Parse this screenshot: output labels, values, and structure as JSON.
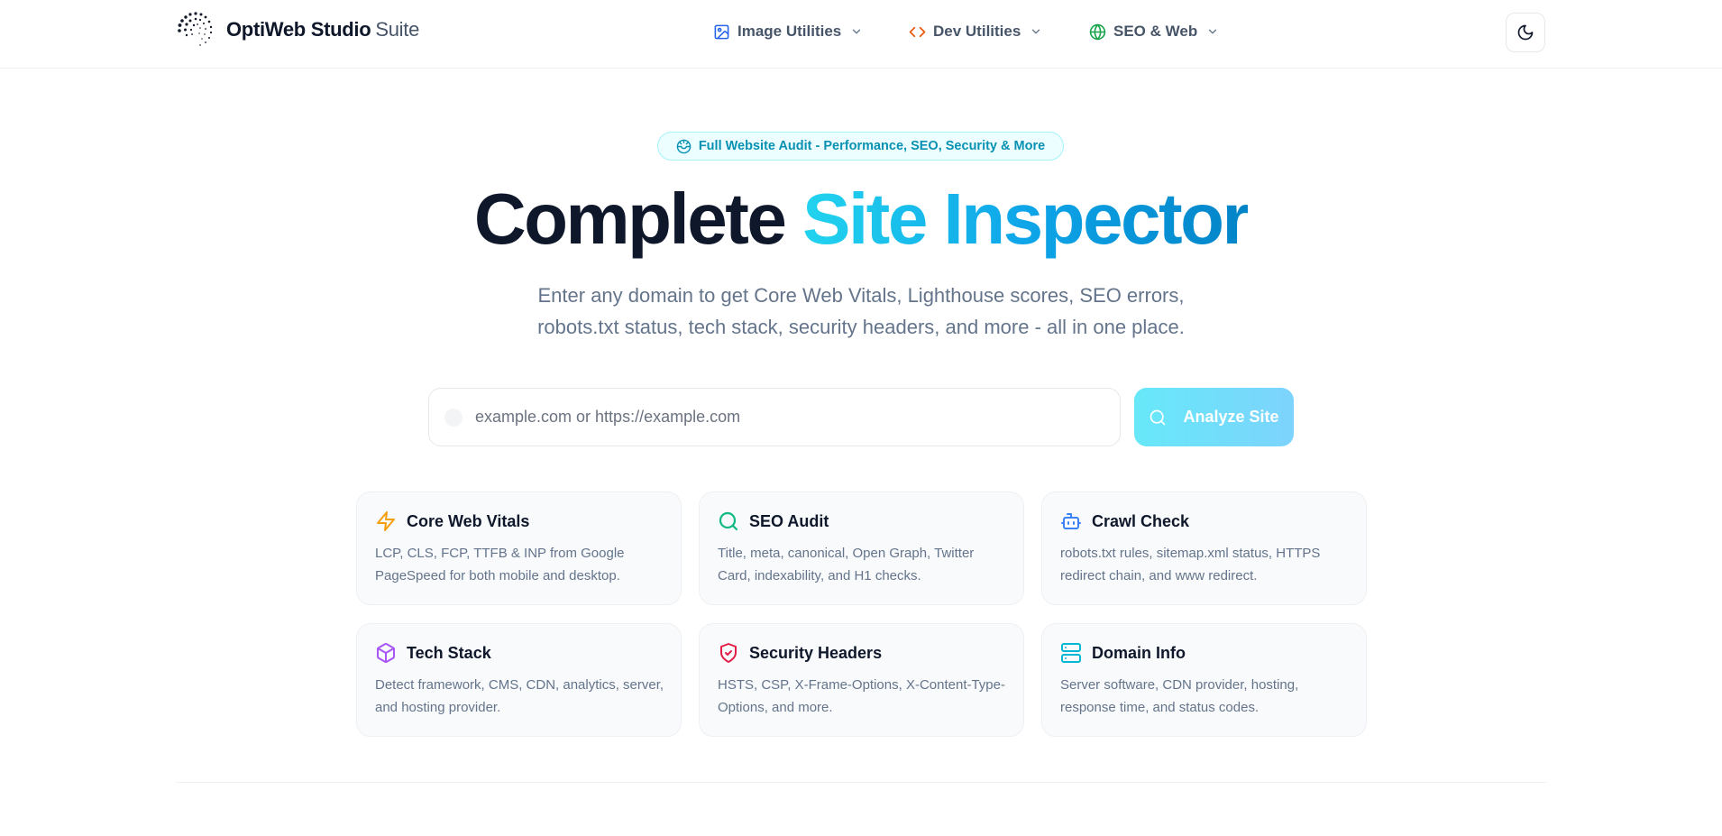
{
  "header": {
    "brand": "OptiWeb Studio",
    "brand_suffix": "Suite",
    "nav": [
      {
        "label": "Image Utilities",
        "icon": "image-icon",
        "color": "#2563eb"
      },
      {
        "label": "Dev Utilities",
        "icon": "code-icon",
        "color": "#ea580c"
      },
      {
        "label": "SEO & Web",
        "icon": "globe-icon",
        "color": "#16a34a"
      }
    ],
    "theme_toggle_icon": "moon-icon"
  },
  "hero": {
    "badge": "Full Website Audit - Performance, SEO, Security & More",
    "title_part1": "Complete",
    "title_part2": "Site Inspector",
    "subtitle_line1": "Enter any domain to get Core Web Vitals, Lighthouse scores, SEO errors,",
    "subtitle_line2": "robots.txt status, tech stack, security headers, and more - all in one place."
  },
  "search": {
    "placeholder": "example.com or https://example.com",
    "value": "",
    "button_label": "Analyze Site"
  },
  "features": [
    {
      "title": "Core Web Vitals",
      "icon": "zap-icon",
      "color": "#f59e0b",
      "desc": "LCP, CLS, FCP, TTFB & INP from Google PageSpeed for both mobile and desktop."
    },
    {
      "title": "SEO Audit",
      "icon": "search-icon",
      "color": "#10b981",
      "desc": "Title, meta, canonical, Open Graph, Twitter Card, indexability, and H1 checks."
    },
    {
      "title": "Crawl Check",
      "icon": "bot-icon",
      "color": "#3b82f6",
      "desc": "robots.txt rules, sitemap.xml status, HTTPS redirect chain, and www redirect."
    },
    {
      "title": "Tech Stack",
      "icon": "box-icon",
      "color": "#a855f7",
      "desc": "Detect framework, CMS, CDN, analytics, server, and hosting provider."
    },
    {
      "title": "Security Headers",
      "icon": "shield-icon",
      "color": "#e11d48",
      "desc": "HSTS, CSP, X-Frame-Options, X-Content-Type-Options, and more."
    },
    {
      "title": "Domain Info",
      "icon": "server-icon",
      "color": "#06b6d4",
      "desc": "Server software, CDN provider, hosting, response time, and status codes."
    }
  ]
}
